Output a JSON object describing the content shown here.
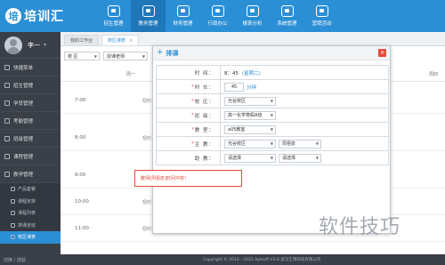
{
  "app": {
    "logo_mark": "培",
    "logo_text": "培训汇"
  },
  "nav": [
    {
      "label": "招生管理",
      "icon": "user-plus-icon"
    },
    {
      "label": "教务管理",
      "icon": "book-icon"
    },
    {
      "label": "财务管理",
      "icon": "money-bag-icon"
    },
    {
      "label": "行政办公",
      "icon": "briefcase-icon"
    },
    {
      "label": "报表分析",
      "icon": "chart-icon"
    },
    {
      "label": "系统管理",
      "icon": "gear-icon"
    },
    {
      "label": "营销活动",
      "icon": "gamepad-icon"
    }
  ],
  "user": {
    "name": "李一",
    "caret": "▾"
  },
  "sidebar": {
    "items": [
      {
        "label": "快捷菜单",
        "icon": "star-icon"
      },
      {
        "label": "招生管理",
        "icon": "user-plus-icon"
      },
      {
        "label": "学员管理",
        "icon": "users-icon"
      },
      {
        "label": "考勤管理",
        "icon": "check-icon"
      },
      {
        "label": "班级管理",
        "icon": "class-icon"
      },
      {
        "label": "课程管理",
        "icon": "course-icon"
      },
      {
        "label": "教学管理",
        "icon": "teach-icon"
      }
    ],
    "sub_items": [
      {
        "label": "产品套餐",
        "active": false
      },
      {
        "label": "课程安排",
        "active": false
      },
      {
        "label": "课程列表",
        "active": false
      },
      {
        "label": "排课走班",
        "active": false
      },
      {
        "label": "校区课表",
        "active": true
      }
    ]
  },
  "tabs": [
    {
      "label": "我的工作台",
      "close": ""
    },
    {
      "label": "校区课表",
      "close": "×"
    }
  ],
  "filters": {
    "campus": "校 区",
    "teacher": "授课老师"
  },
  "grid": {
    "days": [
      "周一",
      "周四"
    ],
    "times": [
      "7:00",
      "8:00",
      "9:00",
      "10:00",
      "11:00"
    ],
    "cell_label": "短时"
  },
  "status": {
    "left": "切换 / 皮肤",
    "copyright": "Copyright © 2014 - 2021 Aptsoft V3.8 武汉汇博科技有限公司"
  },
  "modal": {
    "title": "排课",
    "close": "×",
    "rows": {
      "time_label": "时  间：",
      "time_start": "8：45",
      "time_weekday": "(星期二)",
      "duration_label": "时  长：",
      "duration_value": "45",
      "duration_unit": "分钟",
      "campus_label": "校  区：",
      "campus_value": "光谷校区",
      "class_label": "班  级：",
      "class_value": "高一化学寒假A班",
      "classroom_label": "教  室：",
      "classroom_value": "a05教室",
      "teacher_label": "主  教：",
      "teacher_campus": "光谷校区",
      "teacher_value": "周祖泉",
      "assistant_label": "助  教：",
      "assistant_campus": "请选择",
      "assistant_value": "请选择"
    }
  },
  "conflict": {
    "message": "教师[周祖泉]时间冲突！"
  },
  "watermark": "软件技巧",
  "colors": {
    "primary": "#2b8fd6",
    "danger": "#e24b3b",
    "sidebar": "#3a3f48"
  }
}
